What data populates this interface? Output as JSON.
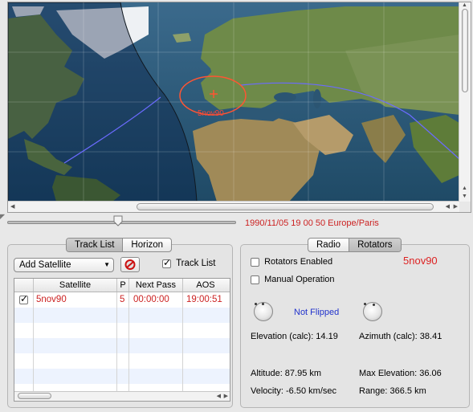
{
  "map": {
    "satellite_label": "5nov90",
    "colors": {
      "ocean": "#2d5876",
      "land": "#6c8b44",
      "ice": "#eef1f4",
      "night_tint": "rgba(0,20,60,0.35)",
      "footprint": "#ff5533",
      "track": "#6b6bff"
    }
  },
  "time": {
    "display": "1990/11/05 19 00 50 Europe/Paris",
    "position_fraction": 0.48
  },
  "left_panel": {
    "tabs": [
      {
        "label": "Track List",
        "active": true
      },
      {
        "label": "Horizon",
        "active": false
      }
    ],
    "add_satellite": "Add Satellite",
    "remove_icon": "no-entry-icon",
    "track_list_checkbox": {
      "label": "Track List",
      "checked": true
    },
    "table": {
      "columns": [
        "",
        "Satellite",
        "P",
        "Next Pass",
        "AOS"
      ],
      "rows": [
        {
          "checked": true,
          "satellite": "5nov90",
          "p": "5",
          "next_pass": "00:00:00",
          "aos": "19:00:51"
        }
      ]
    }
  },
  "right_panel": {
    "tabs": [
      {
        "label": "Radio",
        "active": false
      },
      {
        "label": "Rotators",
        "active": true
      }
    ],
    "satellite_name": "5nov90",
    "rotators_enabled": {
      "label": "Rotators Enabled",
      "checked": false
    },
    "manual_operation": {
      "label": "Manual Operation",
      "checked": false
    },
    "flip_status": "Not Flipped",
    "elevation_calc": "Elevation (calc): 14.19",
    "azimuth_calc": "Azimuth (calc): 38.41",
    "altitude": "Altitude: 87.95 km",
    "max_elevation": "Max Elevation: 36.06",
    "velocity": "Velocity: -6.50 km/sec",
    "range": "Range: 366.5 km",
    "colors": {
      "satellite_name": "#dd2222",
      "flip_status": "#2233cc"
    }
  }
}
